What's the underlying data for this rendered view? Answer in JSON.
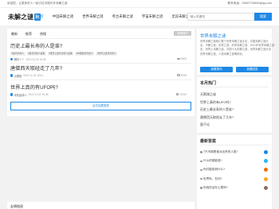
{
  "topbar": {
    "welcome": "欢迎您，让更多的人一起讨论中国中外未解之谜",
    "contact": "联系电话：00667735600@qq.com"
  },
  "header": {
    "logo_text": "未解之谜",
    "logo_badge": "网",
    "nav": [
      "首页",
      "中国未解之谜",
      "世界未解之谜",
      "考古未解之谜",
      "宇宙未解之谜",
      "灵异未解之谜"
    ],
    "search_placeholder": "输入关键词",
    "search_button": "搜索"
  },
  "main": {
    "tabs": [
      "最新",
      "推荐",
      "热搜"
    ],
    "ask_button": "我要提问",
    "questions": [
      {
        "title": "历史上最长寿的人是谁?",
        "tags": [
          "#最长寿的人",
          "#最长寿的人是谁",
          "#世界上最长寿的人是谁",
          "#中国最长寿的人",
          "#世界上最长寿的人"
        ],
        "user": "耀虹丫丫",
        "date": "2022-11-02 16:46",
        "views": "9465"
      },
      {
        "title": "唐僧西天取经走了几年?",
        "tags": [],
        "user": "大眼猫",
        "date": "2022-11-02 16:41",
        "views": "8035"
      },
      {
        "title": "世界上真的有UFO吗?",
        "tags": [],
        "user": "未知星球人",
        "date": "2022-11-01 10:48",
        "views": "10032"
      }
    ],
    "load_more": "点击加载更多"
  },
  "sidebar": {
    "intro": {
      "title": "世界未解之谜",
      "desc_lines": [
        "世界未解之谜网汇集了世界未解之谜大全，中国未解之谜大",
        "全，不解之谜，世界之谜，科学未解之谜、2021年世界未解之谜",
        "全，世界上未解之谜，中国十大未解之谜，世界未解之谜大全",
        "世界未解之谜，人类未解之谜等精彩。"
      ],
      "btn_ask": "我要提问",
      "btn_answer": "我要回答"
    },
    "hot": {
      "heading": "本月热门",
      "items": [
        "天鹅湖之谜",
        "世界上真的有UFO吗?",
        "历史上最长寿的人是谁?",
        "唐僧西天取经走了几年?",
        "量子论"
      ]
    },
    "answers": {
      "heading": "最新答案",
      "items": [
        "7只乌鸦是谁派出来的人类?",
        "什么时候能验?",
        "你们能找到什么?",
        "世界吗，在何?",
        "你真的活在心里吗?"
      ]
    }
  },
  "bottom": {
    "label": "友情链接"
  }
}
